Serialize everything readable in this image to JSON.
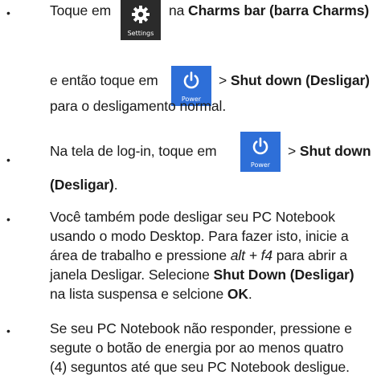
{
  "bullet_char": "•",
  "item1": {
    "line1_text1": "Toque em",
    "line1_text2": "na",
    "line1_bold": "Charms bar (barra Charms)",
    "settings_caption": "Settings",
    "line2_text1": "e então toque em",
    "line2_sep": ">",
    "line2_bold": "Shut down (Desligar)",
    "power_caption": "Power",
    "line3": "para o desligamento normal."
  },
  "item2": {
    "line1_text1": "Na tela de log-in, toque em",
    "line1_sep": ">",
    "line1_bold": "Shut down",
    "power_caption": "Power",
    "line2_bold": "(Desligar)",
    "line2_tail": "."
  },
  "item3": {
    "line1": "Você também pode desligar seu PC Notebook",
    "line2": "usando o modo Desktop. Para fazer isto, inicie a",
    "line3_a": "área de trabalho e pressione",
    "line3_key": "alt + f4",
    "line3_b": "para abrir a",
    "line4_a": "janela Desligar. Selecione",
    "line4_bold": "Shut Down (Desligar)",
    "line5_a": "na lista suspensa e selcione",
    "line5_bold": "OK",
    "line5_b": "."
  },
  "item4": {
    "line1": "Se seu PC Notebook não responder, pressione e",
    "line2": "segute o botão de energia por ao menos quatro",
    "line3": "(4) seguntos até que seu PC Notebook desligue."
  },
  "colors": {
    "power_tile": "#2e6fd8",
    "settings_tile": "#2b2b2b",
    "text": "#1a1a1a"
  },
  "icons": {
    "settings": "gear-icon",
    "power": "power-icon"
  }
}
